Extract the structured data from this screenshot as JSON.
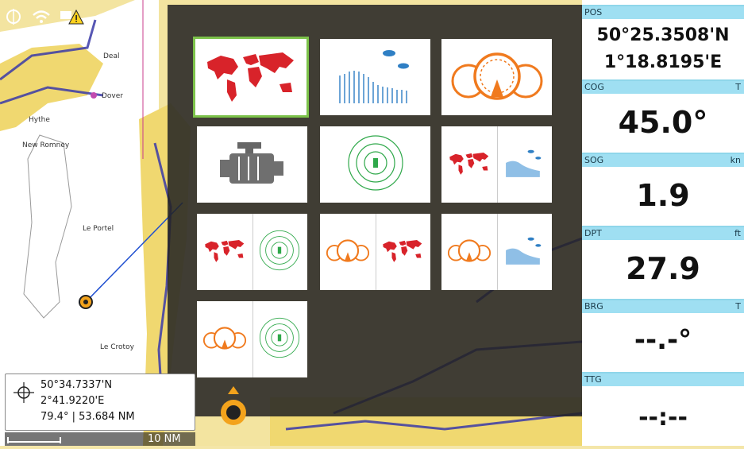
{
  "map": {
    "places": [
      "Deal",
      "Dover",
      "Hythe",
      "New Romney",
      "Le Portel",
      "Le Crotoy"
    ],
    "scale_label": "10 NM"
  },
  "cursor": {
    "lat": "50°34.7337'N",
    "lon": "2°41.9220'E",
    "bearing_range": "79.4° | 53.684 NM"
  },
  "pages_menu": {
    "tiles": [
      {
        "kind": "chart",
        "selected": true
      },
      {
        "kind": "sonar"
      },
      {
        "kind": "instruments"
      },
      {
        "kind": "engine"
      },
      {
        "kind": "radar"
      },
      {
        "kind": "chart+sonar"
      },
      {
        "kind": "chart+radar"
      },
      {
        "kind": "instruments+chart"
      },
      {
        "kind": "instruments+sonar"
      },
      {
        "kind": "instruments+radar"
      }
    ],
    "colors": {
      "chart": "#d8232a",
      "sonar": "#2f7fc4",
      "instruments": "#f07a1e",
      "radar": "#2fa84a",
      "selected_border": "#7cc24a"
    }
  },
  "data_panel": {
    "pos": {
      "label": "POS",
      "lat": "50°25.3508'N",
      "lon": "1°18.8195'E"
    },
    "cog": {
      "label": "COG",
      "unit": "T",
      "value": "45.0°"
    },
    "sog": {
      "label": "SOG",
      "unit": "kn",
      "value": "1.9"
    },
    "dpt": {
      "label": "DPT",
      "unit": "ft",
      "value": "27.9"
    },
    "brg": {
      "label": "BRG",
      "unit": "T",
      "value": "--.-°"
    },
    "ttg": {
      "label": "TTG",
      "unit": "",
      "value": "--:--"
    }
  }
}
